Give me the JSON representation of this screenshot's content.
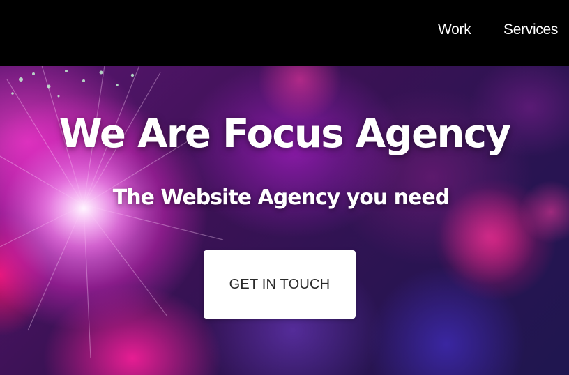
{
  "nav": {
    "items": [
      {
        "label": "Work"
      },
      {
        "label": "Services"
      }
    ]
  },
  "hero": {
    "title": "We Are Focus Agency",
    "subtitle": "The Website Agency you need",
    "cta_label": "GET IN TOUCH"
  },
  "colors": {
    "navbar_background": "#000000",
    "nav_text": "#ffffff",
    "hero_text": "#ffffff",
    "cta_background": "#ffffff",
    "cta_text": "#2a2a2a",
    "hero_accent_pink": "#e0289a",
    "hero_accent_purple": "#5b1570"
  }
}
